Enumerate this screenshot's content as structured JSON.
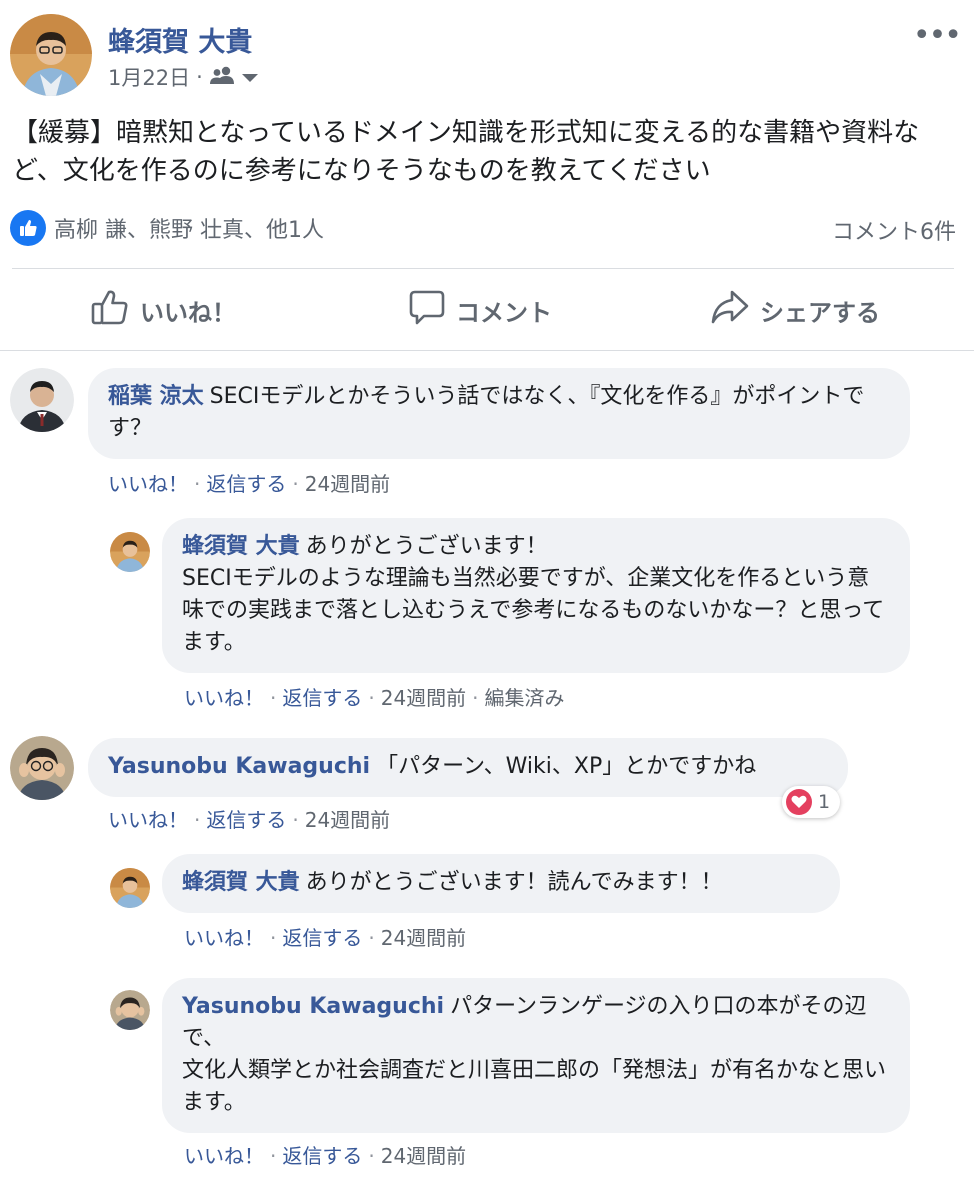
{
  "post": {
    "author": "蜂須賀 大貴",
    "date": "1月22日",
    "privacy_icon": "friends-icon",
    "text": "【緩募】暗黙知となっているドメイン知識を形式知に変える的な書籍や資料など、文化を作るのに参考になりそうなものを教えてください",
    "likers": "高柳 謙、熊野 壮真、他1人",
    "comment_count": "コメント6件"
  },
  "actions": {
    "like": "いいね！",
    "comment": "コメント",
    "share": "シェアする"
  },
  "comments": [
    {
      "name": "稲葉 涼太",
      "text": "SECIモデルとかそういう話ではなく、『文化を作る』がポイントです？",
      "like": "いいね！",
      "reply": "返信する",
      "time": "24週間前"
    },
    {
      "name": "蜂須賀 大貴",
      "text": "ありがとうございます！\nSECIモデルのような理論も当然必要ですが、企業文化を作るという意味での実践まで落とし込むうえで参考になるものないかなー？と思ってます。",
      "like": "いいね！",
      "reply": "返信する",
      "time": "24週間前",
      "edited": "編集済み"
    },
    {
      "name": "Yasunobu Kawaguchi",
      "text": "「パターン、Wiki、XP」とかですかね",
      "like": "いいね！",
      "reply": "返信する",
      "time": "24週間前",
      "reaction_count": "1"
    },
    {
      "name": "蜂須賀 大貴",
      "text": "ありがとうございます！読んでみます！！",
      "like": "いいね！",
      "reply": "返信する",
      "time": "24週間前"
    },
    {
      "name": "Yasunobu Kawaguchi",
      "text": "パターンランゲージの入り口の本がその辺で、\n文化人類学とか社会調査だと川喜田二郎の「発想法」が有名かなと思います。",
      "like": "いいね！",
      "reply": "返信する",
      "time": "24週間前"
    }
  ],
  "colors": {
    "name_link": "#385898",
    "bubble": "#f0f2f5",
    "like_blue": "#1877f2",
    "heart_red": "#e4405f",
    "muted": "#606770"
  }
}
